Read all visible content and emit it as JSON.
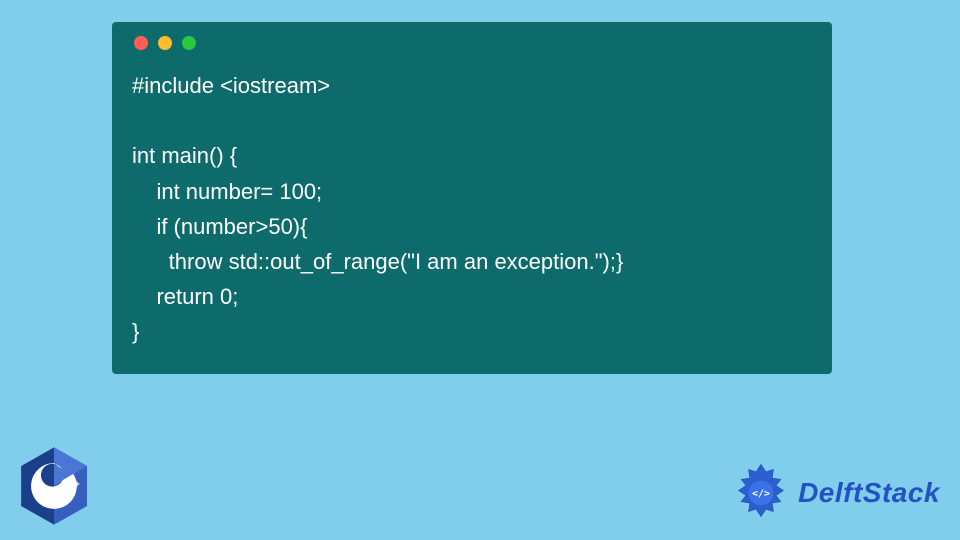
{
  "window": {
    "dots": [
      "red",
      "yellow",
      "green"
    ]
  },
  "code": {
    "lines": [
      "#include <iostream>",
      "",
      "int main() {",
      "    int number= 100;",
      "    if (number>50){",
      "      throw std::out_of_range(\"I am an exception.\");}",
      "    return 0;",
      "}"
    ]
  },
  "logos": {
    "cpp_label": "C++",
    "delft_label": "DelftStack"
  },
  "colors": {
    "background": "#80cdec",
    "window": "#0d6b6b",
    "code_text": "#ffffff",
    "delft_blue": "#2153c4",
    "cpp_blue_dark": "#1b3f8b",
    "cpp_blue_light": "#4a77d4"
  }
}
